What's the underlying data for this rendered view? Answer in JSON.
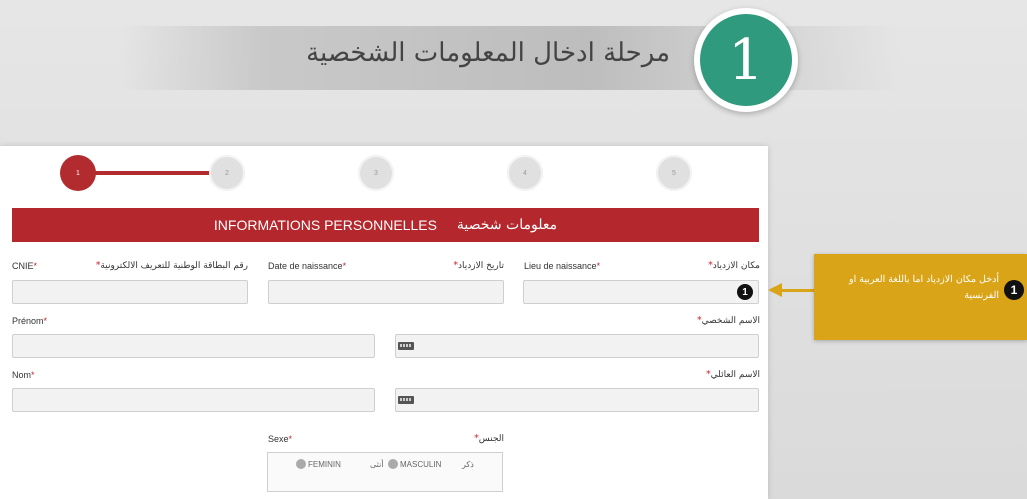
{
  "banner": {
    "title": "مرحلة ادخال المعلومات الشخصية",
    "step_number": "1"
  },
  "stepper": {
    "steps": [
      "1",
      "2",
      "3",
      "4",
      "5"
    ],
    "active": 1
  },
  "section": {
    "title_fr": "INFORMATIONS PERSONNELLES",
    "title_ar": "معلومات شخصية"
  },
  "fields": {
    "cnie": {
      "label_fr": "CNIE",
      "label_ar": "رقم البطاقة الوطنية للتعريف الالكترونية",
      "value": ""
    },
    "date_naissance": {
      "label_fr": "Date de naissance",
      "label_ar": "تاريخ الازدياد",
      "value": ""
    },
    "lieu_naissance": {
      "label_fr": "Lieu de naissance",
      "label_ar": "مكان الازدياد",
      "value": ""
    },
    "prenom": {
      "label_fr": "Prénom",
      "label_ar": "الاسم الشخصي",
      "value": ""
    },
    "nom": {
      "label_fr": "Nom",
      "label_ar": "الاسم العائلي",
      "value": ""
    },
    "sexe": {
      "label_fr": "Sexe",
      "label_ar": "الجنس",
      "options": [
        {
          "fr": "MASCULIN",
          "ar": "ذكر"
        },
        {
          "fr": "FEMININ",
          "ar": "أنثى"
        }
      ]
    }
  },
  "required_mark": "*",
  "marker_number": "1",
  "callout": {
    "number": "1",
    "text": "أدخل مكان الازدياد اما باللغة العربية او الفرنسية"
  },
  "colors": {
    "brand_red": "#b4272c",
    "teal": "#2f9a7e",
    "callout_gold": "#d9a418"
  }
}
